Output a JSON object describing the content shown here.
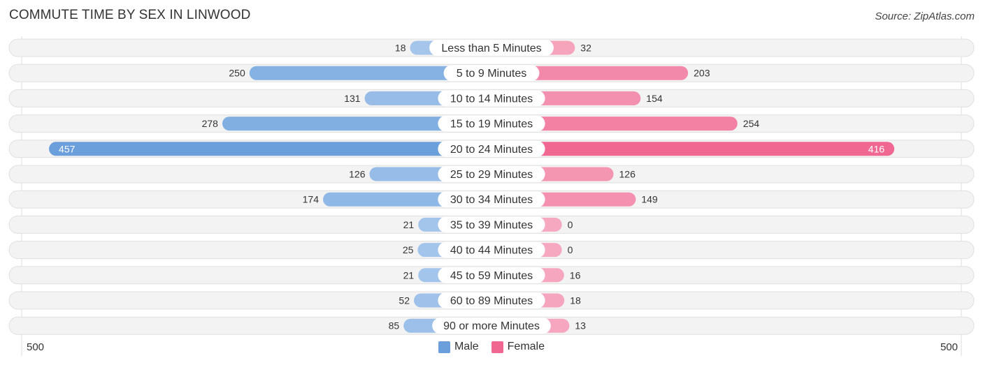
{
  "header": {
    "title": "COMMUTE TIME BY SEX IN LINWOOD",
    "source": "Source: ZipAtlas.com"
  },
  "colors": {
    "male": "#6a9fdb",
    "male_light": "#a7c7ec",
    "female": "#f06892",
    "female_light": "#f6a8c0",
    "track": "#f3f3f3"
  },
  "chart_data": {
    "type": "bar",
    "orientation": "horizontal-diverging",
    "title": "COMMUTE TIME BY SEX IN LINWOOD",
    "categories": [
      "Less than 5 Minutes",
      "5 to 9 Minutes",
      "10 to 14 Minutes",
      "15 to 19 Minutes",
      "20 to 24 Minutes",
      "25 to 29 Minutes",
      "30 to 34 Minutes",
      "35 to 39 Minutes",
      "40 to 44 Minutes",
      "45 to 59 Minutes",
      "60 to 89 Minutes",
      "90 or more Minutes"
    ],
    "series": [
      {
        "name": "Male",
        "values": [
          18,
          250,
          131,
          278,
          457,
          126,
          174,
          21,
          25,
          21,
          52,
          85
        ]
      },
      {
        "name": "Female",
        "values": [
          32,
          203,
          154,
          254,
          416,
          126,
          149,
          0,
          0,
          16,
          18,
          13
        ]
      }
    ],
    "axis": {
      "left_label": "500",
      "right_label": "500",
      "max": 500
    },
    "legend": {
      "position": "bottom-center",
      "entries": [
        "Male",
        "Female"
      ]
    }
  }
}
